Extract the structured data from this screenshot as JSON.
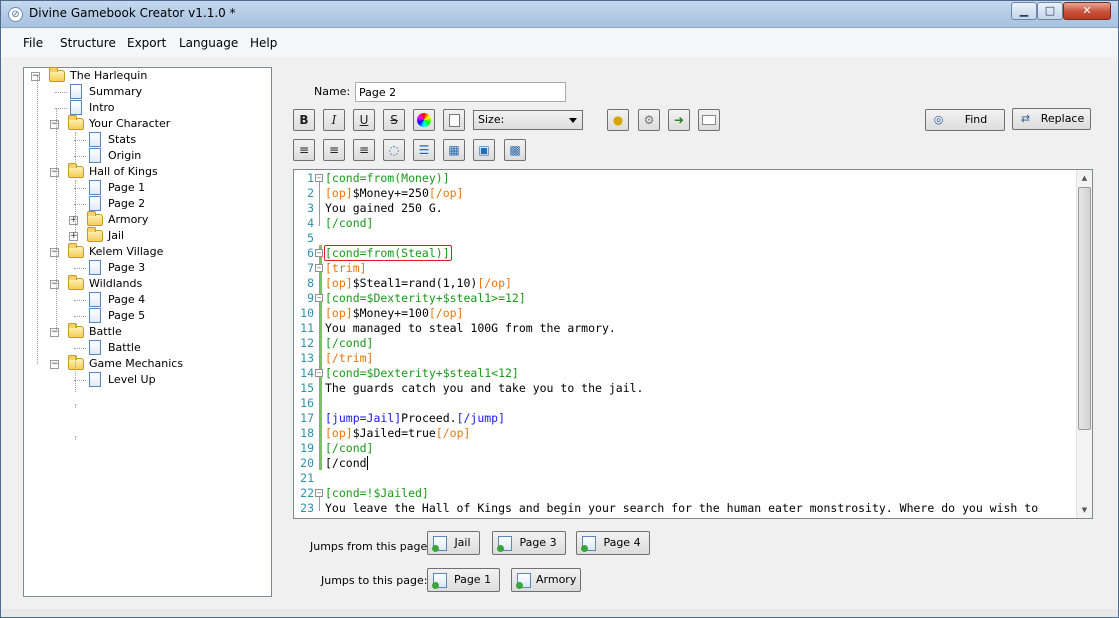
{
  "window": {
    "title": "Divine Gamebook Creator v1.1.0 *",
    "min_icon": "minimize-icon",
    "max_icon": "maximize-icon",
    "close_icon": "close-icon",
    "min_glyph": "▁",
    "max_glyph": "□",
    "close_glyph": "✕"
  },
  "menu": [
    "File",
    "Structure",
    "Export",
    "Language",
    "Help"
  ],
  "tree": [
    {
      "label": "The Harlequin",
      "type": "folder",
      "depth": 0,
      "expander": "−"
    },
    {
      "label": "Summary",
      "type": "page",
      "depth": 1
    },
    {
      "label": "Intro",
      "type": "page",
      "depth": 1
    },
    {
      "label": "Your Character",
      "type": "folder",
      "depth": 1,
      "expander": "−"
    },
    {
      "label": "Stats",
      "type": "page",
      "depth": 2
    },
    {
      "label": "Origin",
      "type": "page",
      "depth": 2
    },
    {
      "label": "Hall of Kings",
      "type": "folder",
      "depth": 1,
      "expander": "−"
    },
    {
      "label": "Page 1",
      "type": "page",
      "depth": 2
    },
    {
      "label": "Page 2",
      "type": "page",
      "depth": 2
    },
    {
      "label": "Armory",
      "type": "folder",
      "depth": 2,
      "expander": "+"
    },
    {
      "label": "Jail",
      "type": "folder",
      "depth": 2,
      "expander": "+"
    },
    {
      "label": "Kelem Village",
      "type": "folder",
      "depth": 1,
      "expander": "−"
    },
    {
      "label": "Page 3",
      "type": "page",
      "depth": 2
    },
    {
      "label": "Wildlands",
      "type": "folder",
      "depth": 1,
      "expander": "−"
    },
    {
      "label": "Page 4",
      "type": "page",
      "depth": 2
    },
    {
      "label": "Page 5",
      "type": "page",
      "depth": 2
    },
    {
      "label": "Battle",
      "type": "folder",
      "depth": 1,
      "expander": "−"
    },
    {
      "label": "Battle",
      "type": "page",
      "depth": 2
    },
    {
      "label": "Game Mechanics",
      "type": "folder",
      "depth": 1,
      "expander": "−"
    },
    {
      "label": "Level Up",
      "type": "page",
      "depth": 2
    }
  ],
  "name_field": {
    "label": "Name:",
    "value": "Page 2"
  },
  "toolbar": {
    "bold": "B",
    "italic": "I",
    "underline": "U",
    "strike": "S",
    "size_select": "Size:",
    "find_label": "Find",
    "replace_label": "Replace"
  },
  "editor": {
    "lines": [
      {
        "n": "1",
        "parts": [
          [
            "[cond=from(Money)]",
            "green"
          ]
        ],
        "fold": "−"
      },
      {
        "n": "2",
        "parts": [
          [
            "[op]",
            "orange"
          ],
          [
            "$Money+=250",
            "black"
          ],
          [
            "[/op]",
            "orange"
          ]
        ]
      },
      {
        "n": "3",
        "parts": [
          [
            "You gained 250 G.",
            "black"
          ]
        ]
      },
      {
        "n": "4",
        "parts": [
          [
            "[/cond]",
            "green"
          ]
        ]
      },
      {
        "n": "5",
        "parts": []
      },
      {
        "n": "6",
        "parts": [
          [
            "[cond=from(Steal)]",
            "green"
          ]
        ],
        "fold": "−"
      },
      {
        "n": "7",
        "parts": [
          [
            "[trim]",
            "orange"
          ]
        ],
        "fold": "−"
      },
      {
        "n": "8",
        "parts": [
          [
            "[op]",
            "orange"
          ],
          [
            "$Steal1=rand(1,10)",
            "black"
          ],
          [
            "[/op]",
            "orange"
          ]
        ]
      },
      {
        "n": "9",
        "parts": [
          [
            "[cond=$Dexterity+$steal1>=12]",
            "green"
          ]
        ],
        "fold": "−"
      },
      {
        "n": "10",
        "parts": [
          [
            "[op]",
            "orange"
          ],
          [
            "$Money+=100",
            "black"
          ],
          [
            "[/op]",
            "orange"
          ]
        ]
      },
      {
        "n": "11",
        "parts": [
          [
            "You managed to steal 100G from the armory.",
            "black"
          ]
        ]
      },
      {
        "n": "12",
        "parts": [
          [
            "[/cond]",
            "green"
          ]
        ]
      },
      {
        "n": "13",
        "parts": [
          [
            "[/trim]",
            "orange"
          ]
        ]
      },
      {
        "n": "14",
        "parts": [
          [
            "[cond=$Dexterity+$steal1<12]",
            "green"
          ]
        ],
        "fold": "−"
      },
      {
        "n": "15",
        "parts": [
          [
            "The guards catch you and take you to the jail.",
            "black"
          ]
        ]
      },
      {
        "n": "16",
        "parts": []
      },
      {
        "n": "17",
        "parts": [
          [
            "[jump=Jail]",
            "blue"
          ],
          [
            "Proceed.",
            "black"
          ],
          [
            "[/jump]",
            "blue"
          ]
        ]
      },
      {
        "n": "18",
        "parts": [
          [
            "[op]",
            "orange"
          ],
          [
            "$Jailed=true",
            "black"
          ],
          [
            "[/op]",
            "orange"
          ]
        ]
      },
      {
        "n": "19",
        "parts": [
          [
            "[/cond]",
            "green"
          ]
        ]
      },
      {
        "n": "20",
        "parts": [
          [
            "[/cond",
            "black"
          ]
        ]
      },
      {
        "n": "21",
        "parts": []
      },
      {
        "n": "22",
        "parts": [
          [
            "[cond=!$Jailed]",
            "green"
          ]
        ],
        "fold": "−"
      },
      {
        "n": "23",
        "parts": [
          [
            "You leave the Hall of Kings and begin your search for the human eater monstrosity. Where do you wish to",
            "black"
          ]
        ]
      }
    ]
  },
  "jumps_from": {
    "label": "Jumps from this page:",
    "items": [
      "Jail",
      "Page 3",
      "Page 4"
    ]
  },
  "jumps_to": {
    "label": "Jumps to this page:",
    "items": [
      "Page 1",
      "Armory"
    ]
  },
  "colors": {
    "green": "#189a19",
    "orange": "#e8760c",
    "blue": "#1818e8"
  }
}
